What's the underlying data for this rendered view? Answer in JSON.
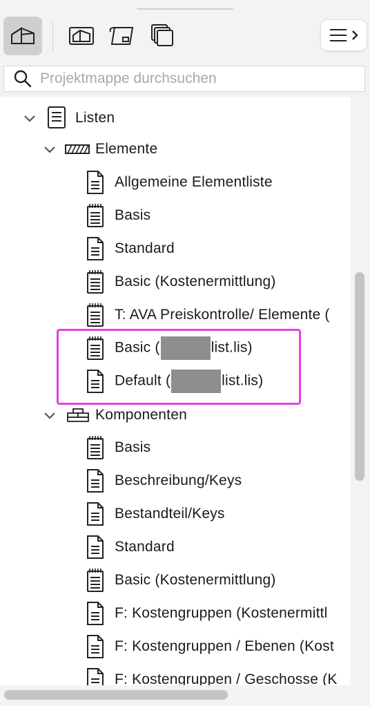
{
  "toolbar": {
    "buttons": [
      {
        "icon": "project-home-icon",
        "active": true
      },
      {
        "icon": "view-map-icon",
        "active": false
      },
      {
        "icon": "layout-book-icon",
        "active": false
      },
      {
        "icon": "publisher-sets-icon",
        "active": false
      }
    ],
    "menu_icon": "hamburger-menu-icon"
  },
  "search": {
    "placeholder": "Projektmappe durchsuchen"
  },
  "tree": {
    "root": {
      "label": "Listen",
      "expanded": true
    },
    "groups": [
      {
        "label": "Elemente",
        "expanded": true,
        "items": [
          "Allgemeine Elementliste",
          "Basis",
          "Standard",
          "Basic (Kostenermittlung)",
          "T: AVA Preiskontrolle/ Elemente (",
          {
            "prefix": "Basic (",
            "suffix": "list.lis)",
            "redacted": true
          },
          {
            "prefix": "Default (",
            "suffix": "list.lis)",
            "redacted": true
          }
        ]
      },
      {
        "label": "Komponenten",
        "expanded": true,
        "items": [
          "Basis",
          "Beschreibung/Keys",
          "Bestandteil/Keys",
          "Standard",
          "Basic (Kostenermittlung)",
          "F: Kostengruppen (Kostenermittl",
          "F: Kostengruppen / Ebenen (Kost",
          "F: Kostengruppen / Geschosse (K"
        ]
      }
    ]
  },
  "colors": {
    "highlight": "#e23fe2",
    "redaction": "#8e8e8e"
  }
}
